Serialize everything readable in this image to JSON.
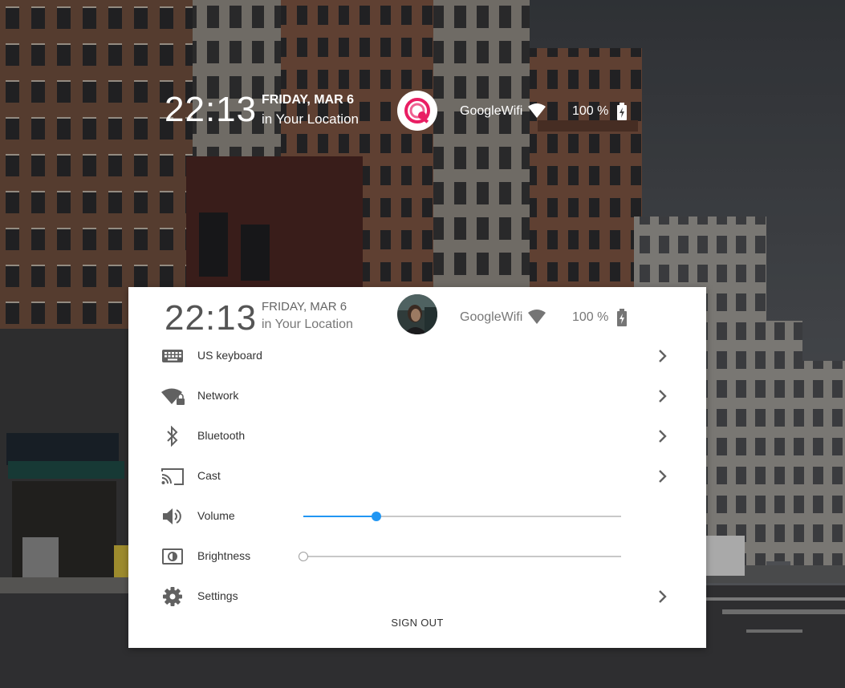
{
  "lock_status": {
    "time": "22:13",
    "date": "FRIDAY, MAR 6",
    "location": "in Your Location",
    "network_name": "GoogleWifi",
    "battery": "100 %"
  },
  "menu": {
    "time": "22:13",
    "date": "FRIDAY, MAR 6",
    "location": "in Your Location",
    "network_name": "GoogleWifi",
    "battery": "100 %",
    "items": {
      "keyboard": "US keyboard",
      "network": "Network",
      "bluetooth": "Bluetooth",
      "cast": "Cast",
      "volume": "Volume",
      "brightness": "Brightness",
      "settings": "Settings"
    },
    "volume_level": 0.23,
    "brightness_level": 0.0,
    "sign_out": "SIGN OUT"
  },
  "icons": {
    "keyboard": "keyboard-icon",
    "network": "wifi-locked-icon",
    "bluetooth": "bluetooth-icon",
    "cast": "cast-icon",
    "volume": "speaker-icon",
    "brightness": "brightness-icon",
    "settings": "gear-icon",
    "chevron": "chevron-right-icon"
  },
  "colors": {
    "accent": "#2196f3",
    "avatar_brand": "#e91e63"
  }
}
